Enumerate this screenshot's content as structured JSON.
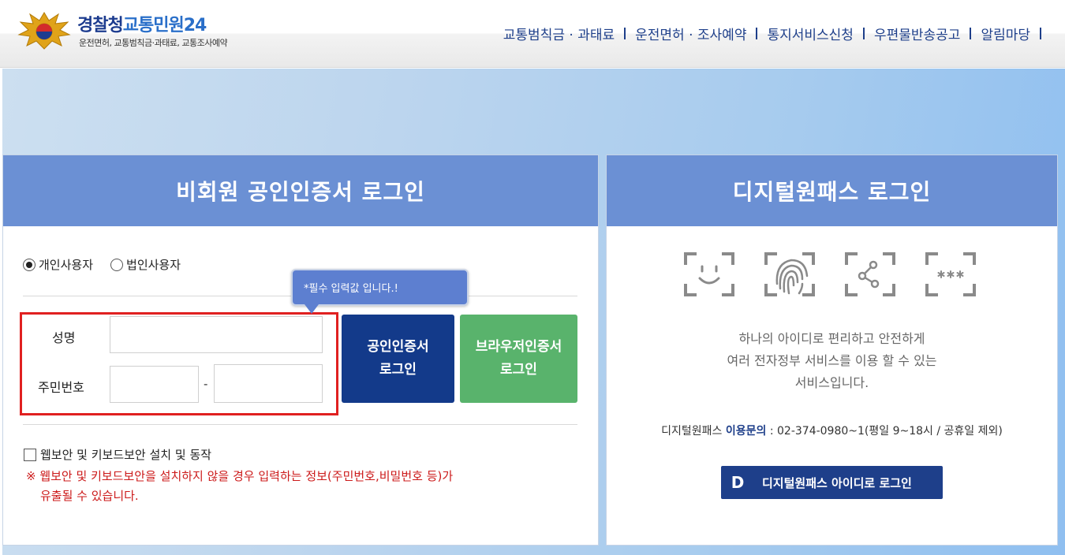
{
  "header": {
    "logo_title_main": "경찰청",
    "logo_title_sub": "교통민원24",
    "logo_tagline": "운전면허, 교통범칙금·과태료, 교통조사예약",
    "nav": [
      {
        "label": "교통범칙금 · 과태료"
      },
      {
        "label": "운전면허 · 조사예약"
      },
      {
        "label": "통지서비스신청"
      },
      {
        "label": "우편물반송공고"
      },
      {
        "label": "알림마당"
      }
    ]
  },
  "left_panel": {
    "title": "비회원 공인인증서 로그인",
    "user_type": {
      "options": [
        "개인사용자",
        "법인사용자"
      ],
      "selected": "개인사용자"
    },
    "tooltip": "*필수 입력값 입니다.!",
    "name_label": "성명",
    "rrn_label": "주민번호",
    "rrn_separator": "-",
    "cert_button": {
      "line1": "공인인증서",
      "line2": "로그인"
    },
    "browser_button": {
      "line1": "브라우저인증서",
      "line2": "로그인"
    },
    "security_checkbox": "웹보안 및 키보드보안 설치 및 동작",
    "warning_line1": "※ 웹보안 및 키보드보안을 설치하지 않을 경우 입력하는 정보(주민번호,비밀번호 등)가",
    "warning_line2": "유출될 수 있습니다."
  },
  "right_panel": {
    "title": "디지털원패스 로그인",
    "icons": [
      "face-id-icon",
      "fingerprint-icon",
      "pattern-icon",
      "pin-icon"
    ],
    "description": [
      "하나의 아이디로 편리하고 안전하게",
      "여러 전자정부 서비스를 이용 할 수 있는",
      "서비스입니다."
    ],
    "contact_prefix": "디지털원패스",
    "contact_strong": "이용문의",
    "contact_detail": ": 02-374-0980~1(평일 9~18시 / 공휴일 제외)",
    "login_button": {
      "badge": "D",
      "label": "디지털원패스 아이디로 로그인"
    }
  },
  "colors": {
    "panel_header": "#6b90d4",
    "navy": "#1e3f8a",
    "cert_button": "#133a8a",
    "browser_button": "#59b36c",
    "warning": "#cc1a1a",
    "highlight_box": "#e02020"
  }
}
